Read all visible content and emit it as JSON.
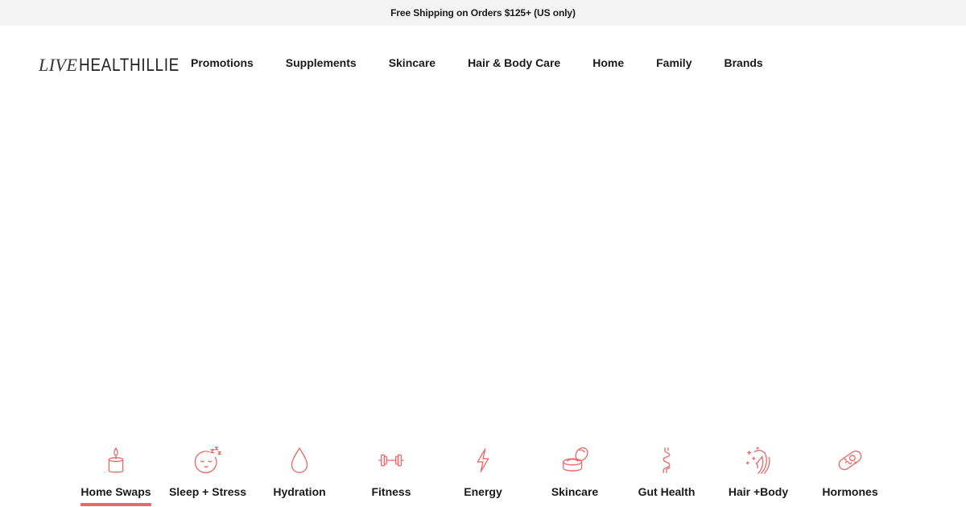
{
  "announcement": {
    "text": "Free Shipping on Orders $125+ (US only)"
  },
  "logo": {
    "live": "LIVE",
    "brand": "HEALTHILLIE"
  },
  "nav": {
    "items": [
      {
        "label": "Promotions"
      },
      {
        "label": "Supplements"
      },
      {
        "label": "Skincare"
      },
      {
        "label": "Hair & Body Care"
      },
      {
        "label": "Home"
      },
      {
        "label": "Family"
      },
      {
        "label": "Brands"
      }
    ]
  },
  "categories": {
    "accent_color": "#e86a6a",
    "active_index": 0,
    "items": [
      {
        "label": "Home Swaps",
        "icon": "candle-icon"
      },
      {
        "label": "Sleep + Stress",
        "icon": "sleepy-face-icon"
      },
      {
        "label": "Hydration",
        "icon": "water-drop-icon"
      },
      {
        "label": "Fitness",
        "icon": "dumbbell-icon"
      },
      {
        "label": "Energy",
        "icon": "lightning-icon"
      },
      {
        "label": "Skincare",
        "icon": "cream-jar-icon"
      },
      {
        "label": "Gut Health",
        "icon": "intestine-icon"
      },
      {
        "label": "Hair +Body",
        "icon": "hair-profile-icon"
      },
      {
        "label": "Hormones",
        "icon": "hormone-patch-icon"
      }
    ]
  }
}
